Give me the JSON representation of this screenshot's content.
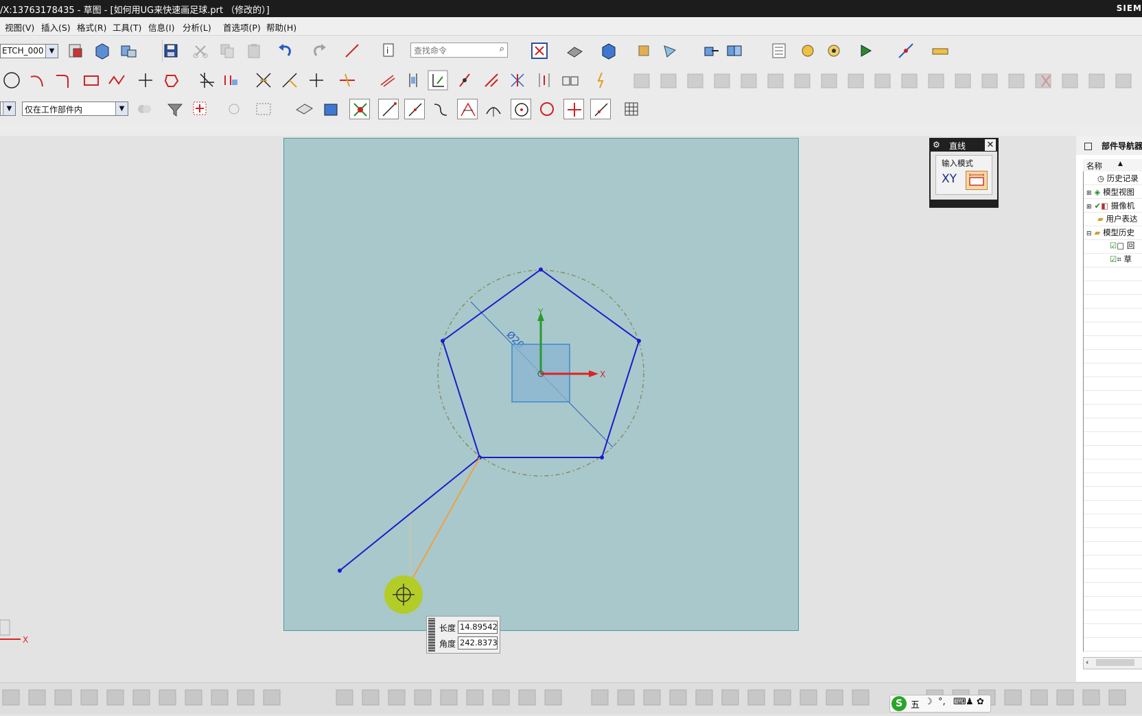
{
  "window": {
    "title": "/X:13763178435 - 草图 - [如何用UG来快速画足球.prt （修改的）]",
    "brand": "SIEM"
  },
  "menu": [
    "视图(V)",
    "插入(S)",
    "格式(R)",
    "工具(T)",
    "信息(I)",
    "分析(L)",
    "首选项(P)",
    "帮助(H)"
  ],
  "toolbar": {
    "sketch_name": "ETCH_000",
    "search_placeholder": "查找命令",
    "filter_scope": "仅在工作部件内"
  },
  "icons": {
    "save": "save-icon",
    "cut": "cut-icon",
    "copy": "copy-icon",
    "paste": "paste-icon",
    "undo": "undo-icon",
    "redo": "redo-icon",
    "search": "search-icon",
    "circle": "circle-icon",
    "arc": "arc-icon",
    "line": "line-icon",
    "rectangle": "rectangle-icon",
    "point": "point-icon",
    "trim": "trim-icon",
    "grid": "grid-icon",
    "close": "close-icon",
    "gear": "gear-icon"
  },
  "line_dialog": {
    "title": "直线",
    "section": "输入模式",
    "mode_xy": "XY"
  },
  "dynamic_input": {
    "length_label": "长度",
    "length_value": "14.89542",
    "angle_label": "角度",
    "angle_value": "242.8373"
  },
  "sketch": {
    "dimension_label": "Ø20",
    "axis_x": "X",
    "axis_y": "Y",
    "origin_axis_x": "X"
  },
  "navigator": {
    "title": "部件导航器",
    "column": "名称",
    "items": [
      "历史记录",
      "模型视图",
      "摄像机",
      "用户表达",
      "模型历史",
      "回",
      "草"
    ]
  },
  "ime": {
    "label": "五"
  },
  "colors": {
    "sketch_plane": "#a8c8cb",
    "pentagon": "#1a1acc",
    "rubber_band": "#f0a040",
    "cursor": "#b4cc28"
  }
}
